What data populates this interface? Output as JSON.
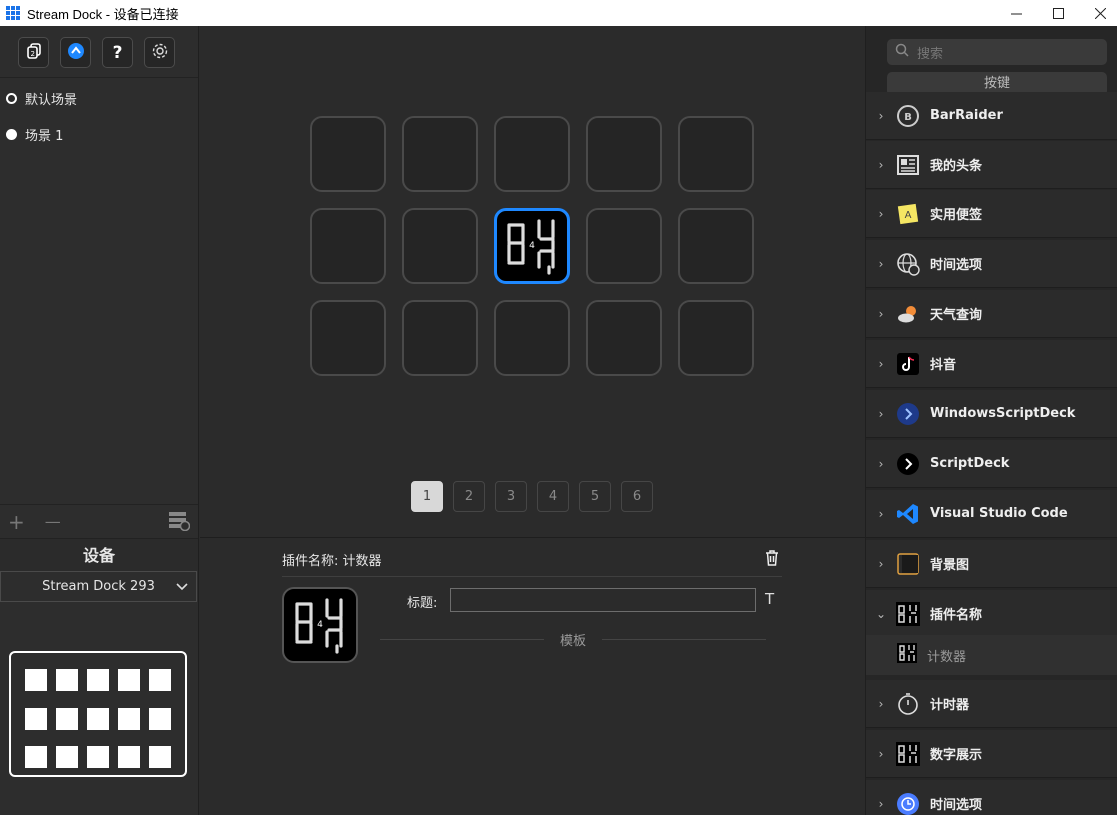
{
  "window": {
    "title": "Stream Dock - 设备已连接",
    "minimize_glyph": "—",
    "maximize_glyph": "☐",
    "close_glyph": "✕"
  },
  "toolbar": {
    "buttons": [
      {
        "name": "profile-icon"
      },
      {
        "name": "store-icon"
      },
      {
        "name": "help-icon",
        "glyph": "?"
      },
      {
        "name": "gear-icon"
      }
    ]
  },
  "scenes": [
    {
      "label": "默认场景",
      "selected": false
    },
    {
      "label": "场景 1",
      "selected": true
    }
  ],
  "scene_actions": {
    "add": "+",
    "remove": "—"
  },
  "device": {
    "header": "设备",
    "selected": "Stream Dock 293"
  },
  "keys": {
    "rows": 3,
    "cols": 5,
    "active_index": 7,
    "counter_value": "4"
  },
  "pages": [
    "1",
    "2",
    "3",
    "4",
    "5",
    "6"
  ],
  "current_page": "1",
  "properties": {
    "plugin_name": "插件名称: 计数器",
    "title_label": "标题:",
    "title_value": "",
    "title_format_glyph": "T",
    "template_label": "模板"
  },
  "right": {
    "search_placeholder": "搜索",
    "category_button": "按键",
    "plugins": [
      {
        "label": "BarRaider",
        "icon": "barraider-icon",
        "expanded": false
      },
      {
        "label": "我的头条",
        "icon": "news-icon",
        "expanded": false
      },
      {
        "label": "实用便签",
        "icon": "sticky-note-icon",
        "expanded": false
      },
      {
        "label": "时间选项",
        "icon": "globe-clock-icon",
        "expanded": false
      },
      {
        "label": "天气查询",
        "icon": "weather-icon",
        "expanded": false
      },
      {
        "label": "抖音",
        "icon": "tiktok-icon",
        "expanded": false
      },
      {
        "label": "WindowsScriptDeck",
        "icon": "windows-scriptdeck-icon",
        "expanded": false
      },
      {
        "label": "ScriptDeck",
        "icon": "scriptdeck-icon",
        "expanded": false
      },
      {
        "label": "Visual Studio Code",
        "icon": "vscode-icon",
        "expanded": false
      },
      {
        "label": "背景图",
        "icon": "background-icon",
        "expanded": false
      },
      {
        "label": "插件名称",
        "icon": "counter-icon",
        "expanded": true,
        "children": [
          {
            "label": "计数器",
            "icon": "counter-icon"
          }
        ]
      },
      {
        "label": "计时器",
        "icon": "stopwatch-icon",
        "expanded": false
      },
      {
        "label": "数字展示",
        "icon": "counter-icon",
        "expanded": false
      },
      {
        "label": "时间选项",
        "icon": "clock-icon",
        "expanded": false
      }
    ]
  },
  "colors": {
    "accent": "#1e88ff",
    "background": "#2b2b2b"
  }
}
